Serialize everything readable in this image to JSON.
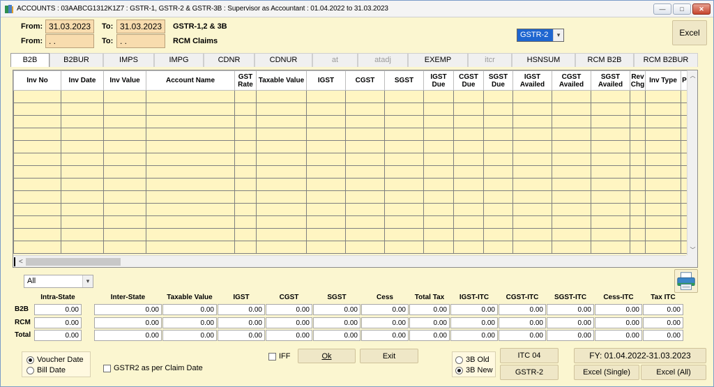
{
  "window": {
    "title": "ACCOUNTS : 03AABCG1312K1Z7 : GSTR-1, GSTR-2 & GSTR-3B : Supervisor as Accountant : 01.04.2022 to 31.03.2023",
    "controls": {
      "minimize": "—",
      "maximize": "□",
      "close": "✕"
    }
  },
  "filters": {
    "row1": {
      "from_label": "From:",
      "from_value": "31.03.2023",
      "to_label": "To:",
      "to_value": "31.03.2023",
      "caption": "GSTR-1,2 & 3B"
    },
    "row2": {
      "from_label": "From:",
      "from_value": " .  .",
      "to_label": "To:",
      "to_value": " .  .",
      "caption": "RCM Claims"
    },
    "return_select": "GSTR-2",
    "excel_label": "Excel"
  },
  "tabs": [
    {
      "label": "B2B",
      "state": "active"
    },
    {
      "label": "B2BUR",
      "state": "normal"
    },
    {
      "label": "IMPS",
      "state": "normal"
    },
    {
      "label": "IMPG",
      "state": "normal"
    },
    {
      "label": "CDNR",
      "state": "normal"
    },
    {
      "label": "CDNUR",
      "state": "normal"
    },
    {
      "label": "at",
      "state": "disabled"
    },
    {
      "label": "atadj",
      "state": "disabled"
    },
    {
      "label": "EXEMP",
      "state": "normal"
    },
    {
      "label": "itcr",
      "state": "disabled"
    },
    {
      "label": "HSNSUM",
      "state": "normal"
    },
    {
      "label": "RCM B2B",
      "state": "normal"
    },
    {
      "label": "RCM B2BUR",
      "state": "normal"
    }
  ],
  "grid": {
    "columns": [
      "Inv No",
      "Inv Date",
      "Inv Value",
      "Account Name",
      "GST Rate",
      "Taxable Value",
      "IGST",
      "CGST",
      "SGST",
      "IGST Due",
      "CGST Due",
      "SGST Due",
      "IGST Availed",
      "CGST Availed",
      "SGST Availed",
      "Rev Chg",
      "Inv Type",
      "P"
    ],
    "empty_rows": 13
  },
  "summary": {
    "filter_select": "All",
    "headers": [
      "Intra-State",
      "Inter-State",
      "Taxable Value",
      "IGST",
      "CGST",
      "SGST",
      "Cess",
      "Total Tax",
      "IGST-ITC",
      "CGST-ITC",
      "SGST-ITC",
      "Cess-ITC",
      "Tax ITC"
    ],
    "rows": [
      {
        "label": "B2B",
        "values": [
          "0.00",
          "0.00",
          "0.00",
          "0.00",
          "0.00",
          "0.00",
          "0.00",
          "0.00",
          "0.00",
          "0.00",
          "0.00",
          "0.00",
          "0.00"
        ]
      },
      {
        "label": "RCM",
        "values": [
          "0.00",
          "0.00",
          "0.00",
          "0.00",
          "0.00",
          "0.00",
          "0.00",
          "0.00",
          "0.00",
          "0.00",
          "0.00",
          "0.00",
          "0.00"
        ]
      },
      {
        "label": "Total",
        "values": [
          "0.00",
          "0.00",
          "0.00",
          "0.00",
          "0.00",
          "0.00",
          "0.00",
          "0.00",
          "0.00",
          "0.00",
          "0.00",
          "0.00",
          "0.00"
        ]
      }
    ]
  },
  "bottom": {
    "date_mode": {
      "voucher": "Voucher Date",
      "bill": "Bill Date",
      "selected": "voucher"
    },
    "gstr2_claim_label": "GSTR2 as per Claim Date",
    "iff_label": "IFF",
    "ok_label": "Ok",
    "exit_label": "Exit",
    "mode_3b": {
      "old": "3B Old",
      "new": "3B New",
      "selected": "new"
    },
    "itc04_label": "ITC 04",
    "gstr2_label": "GSTR-2",
    "fy_label": "FY: 01.04.2022-31.03.2023",
    "excel_single_label": "Excel (Single)",
    "excel_all_label": "Excel (All)"
  },
  "icons": {
    "app": "accounts-app-icon",
    "print": "printer-icon",
    "dropdown": "chevron-down-icon"
  }
}
